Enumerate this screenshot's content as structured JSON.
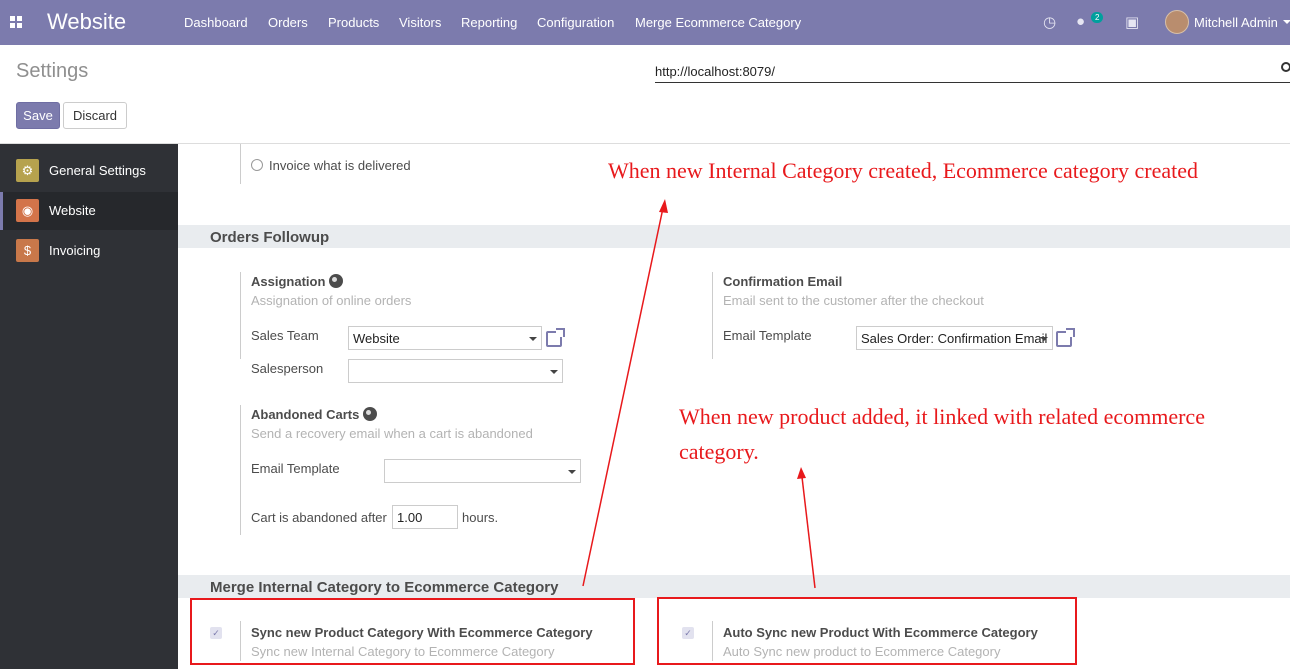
{
  "navbar": {
    "brand": "Website",
    "menu": [
      "Dashboard",
      "Orders",
      "Products",
      "Visitors",
      "Reporting",
      "Configuration",
      "Merge Ecommerce Category"
    ],
    "chat_badge": "2",
    "user_name": "Mitchell Admin",
    "icons": [
      "apps-icon",
      "clock-icon",
      "chat-icon",
      "gift-icon",
      "avatar",
      "caret-down-icon"
    ]
  },
  "control_panel": {
    "title": "Settings",
    "search_value": "http://localhost:8079/",
    "save_label": "Save",
    "discard_label": "Discard"
  },
  "sidebar": {
    "items": [
      {
        "label": "General Settings",
        "icon": "gear-icon",
        "color": "#b6a24e"
      },
      {
        "label": "Website",
        "icon": "globe-icon",
        "color": "#d3744a",
        "active": true
      },
      {
        "label": "Invoicing",
        "icon": "invoice-icon",
        "color": "#c8784a"
      }
    ]
  },
  "invoicing": {
    "option_delivered": "Invoice what is delivered"
  },
  "orders_followup": {
    "section_title": "Orders Followup",
    "assignation": {
      "title": "Assignation",
      "desc": "Assignation of online orders",
      "sales_team_label": "Sales Team",
      "sales_team_value": "Website",
      "salesperson_label": "Salesperson",
      "salesperson_value": ""
    },
    "confirmation_email": {
      "title": "Confirmation Email",
      "desc": "Email sent to the customer after the checkout",
      "template_label": "Email Template",
      "template_value": "Sales Order: Confirmation Email"
    },
    "abandoned_carts": {
      "title": "Abandoned Carts",
      "desc": "Send a recovery email when a cart is abandoned",
      "template_label": "Email Template",
      "template_value": "",
      "after_label": "Cart is abandoned after",
      "after_value": "1.00",
      "hours_label": "hours."
    }
  },
  "merge_section": {
    "section_title": "Merge Internal Category to Ecommerce Category",
    "sync_category": {
      "title": "Sync new Product Category With Ecommerce Category",
      "desc": "Sync new Internal Category to Ecommerce Category",
      "checked": true
    },
    "auto_sync": {
      "title": "Auto Sync new Product With Ecommerce Category",
      "desc": "Auto Sync new product to Ecommerce Category",
      "checked": true
    }
  },
  "annotations": {
    "top": "When new Internal Category created, Ecommerce category created",
    "middle_line1": "When new product added, it linked with related ecommerce",
    "middle_line2": "category.",
    "color": "#e8191c"
  }
}
